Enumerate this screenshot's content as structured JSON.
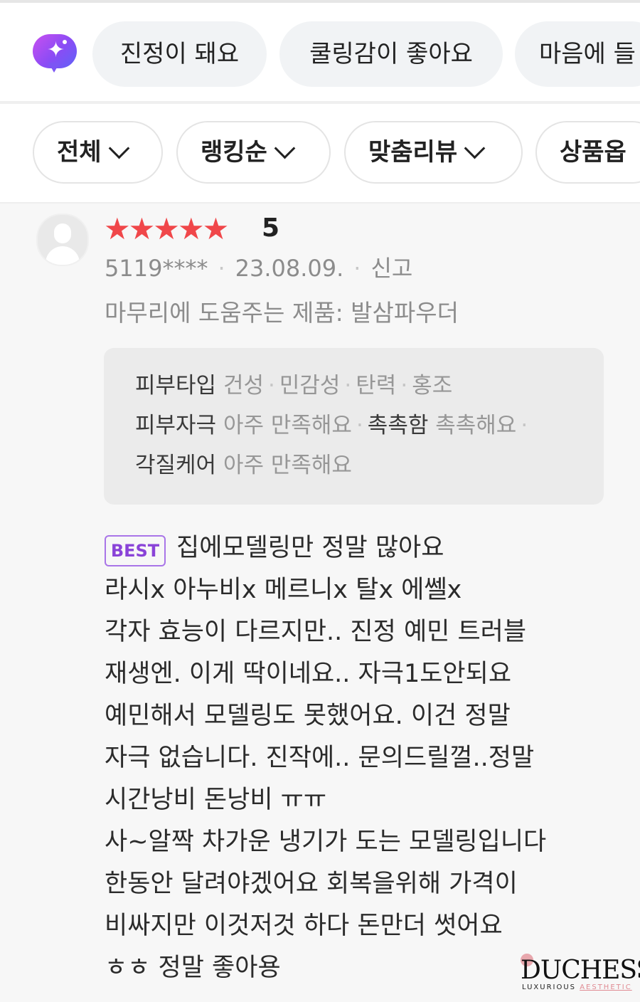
{
  "keyword_chips": [
    "진정이 돼요",
    "쿨링감이 좋아요",
    "마음에 들"
  ],
  "filters": [
    "전체",
    "랭킹순",
    "맞춤리뷰",
    "상품옵"
  ],
  "review": {
    "stars": "★★★★★",
    "rating": "5",
    "user": "5119****",
    "date": "23.08.09.",
    "report": "신고",
    "helpful_product": "마무리에 도움주는 제품: 발삼파우더",
    "attributes": {
      "skin_type_label": "피부타입",
      "skin_type_values": [
        "건성",
        "민감성",
        "탄력",
        "홍조"
      ],
      "irritation_label": "피부자극",
      "irritation_value": "아주 만족해요",
      "moisture_label": "촉촉함",
      "moisture_value": "촉촉해요",
      "keratin_label": "각질케어",
      "keratin_value": "아주 만족해요"
    },
    "badge": "BEST",
    "lines": [
      "집에모델링만 정말 많아요",
      "라시x 아누비x 메르니x 탈x 에쎌x",
      "각자 효능이 다르지만.. 진정 예민 트러블",
      "재생엔. 이게 딱이네요.. 자극1도안되요",
      "예민해서 모델링도 못했어요. 이건 정말",
      "자극 없습니다. 진작에.. 문의드릴껄..정말",
      "시간낭비 돈낭비 ㅠㅠ",
      "사~알짝 차가운 냉기가 도는 모델링입니다",
      "한동안 달려야겠어요 회복을위해 가격이",
      "비싸지만 이것저것 하다 돈만더 썻어요",
      "ㅎㅎ 정말 좋아용"
    ]
  },
  "watermark": {
    "brand": "DUCHESS",
    "tag1": "LUXURIOUS",
    "tag2": "AESTHETIC"
  },
  "colors": {
    "star": "#f0474a",
    "best_badge": "#8a43d8",
    "ai_gradient_start": "#c94ff0",
    "ai_gradient_end": "#5f63f7"
  },
  "icons": [
    "ai-review-sparkle-icon",
    "chevron-down-icon",
    "default-avatar-icon"
  ]
}
